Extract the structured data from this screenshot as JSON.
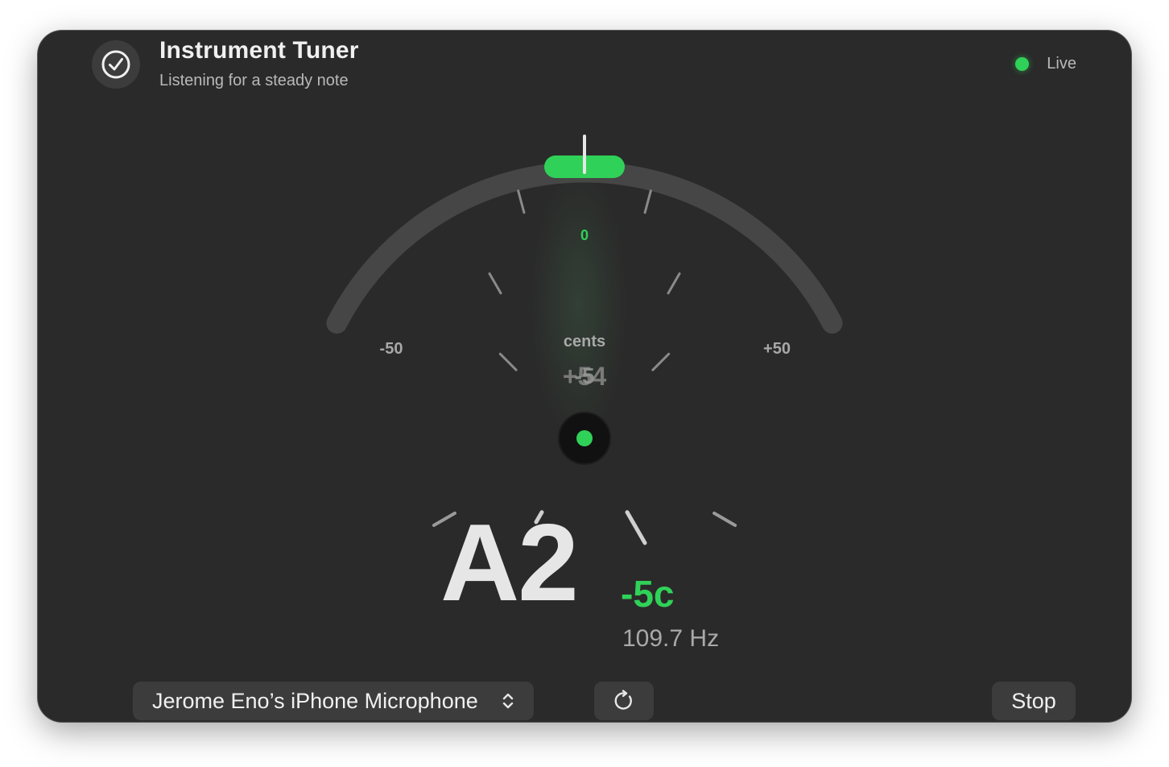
{
  "header": {
    "title": "Instrument Tuner",
    "subtitle": "Listening for a steady note",
    "app_icon": "checkmark-circle-icon",
    "status_label": "Live",
    "status_color": "#30d158"
  },
  "gauge": {
    "min_label": "-50",
    "max_label": "+50",
    "center_label": "0",
    "unit_label": "cents",
    "overlay_text_a": "+54",
    "overlay_text_b": "-5",
    "needle_cents": -5,
    "in_tune_color": "#30d158"
  },
  "reading": {
    "note": "A2",
    "cents_text": "-5c",
    "frequency_text": "109.7 Hz"
  },
  "controls": {
    "input_device": "Jerome Eno’s iPhone Microphone",
    "input_device_icon": "chevron-up-down-icon",
    "refresh_icon": "refresh-icon",
    "stop_label": "Stop"
  },
  "colors": {
    "window_bg": "#2a2a2a",
    "accent": "#30d158"
  }
}
